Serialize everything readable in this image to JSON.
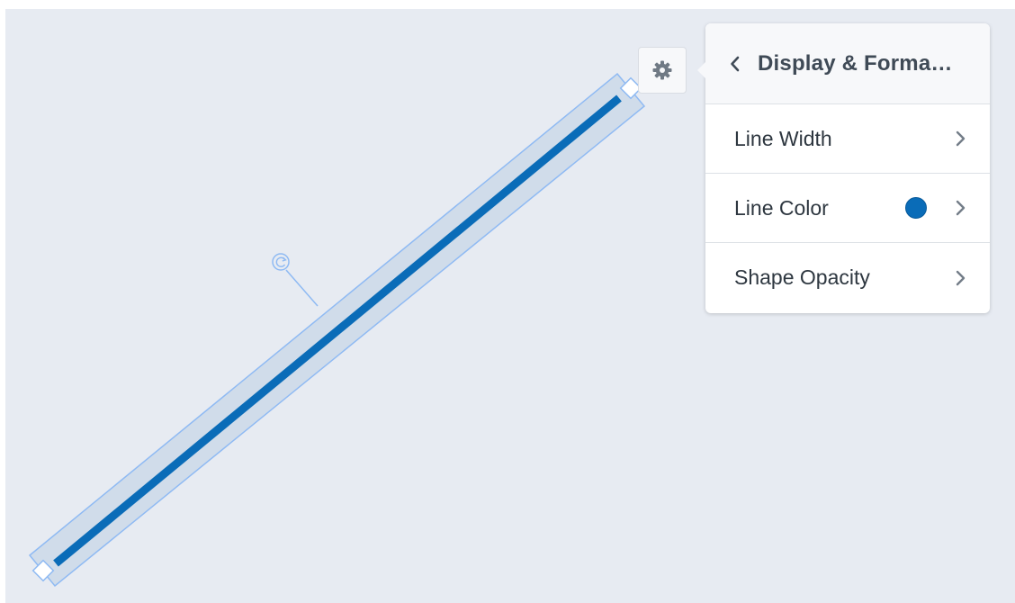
{
  "canvas": {
    "background_color": "#e7ebf2",
    "line_color": "#0a6cb8",
    "selection_color": "#8fbaf3"
  },
  "gear_button": {
    "icon": "gear-icon"
  },
  "panel": {
    "back_icon": "chevron-left-icon",
    "title": "Display & Forma…",
    "rows": [
      {
        "label": "Line Width",
        "icon": "chevron-right-icon"
      },
      {
        "label": "Line Color",
        "swatch_color": "#0a6cb8",
        "icon": "chevron-right-icon"
      },
      {
        "label": "Shape Opacity",
        "icon": "chevron-right-icon"
      }
    ]
  }
}
